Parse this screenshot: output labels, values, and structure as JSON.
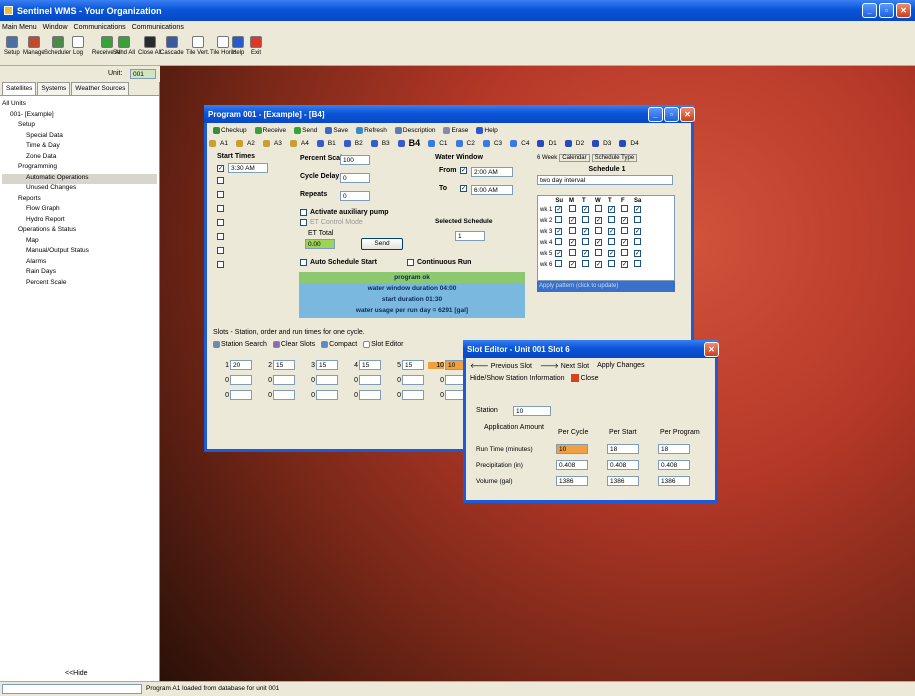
{
  "app_title": "Sentinel WMS - Your Organization",
  "menu": [
    "Main Menu",
    "Window",
    "Communications",
    "Communications"
  ],
  "toolbar": [
    {
      "label": "Setup",
      "icon": "setup-icon",
      "color": "#4a6fa5"
    },
    {
      "label": "Manage",
      "icon": "manage-icon",
      "color": "#c04a30"
    },
    {
      "label": "Scheduler",
      "icon": "scheduler-icon",
      "color": "#4a8a4a"
    },
    {
      "label": "Log",
      "icon": "log-icon",
      "color": "#ffffff"
    },
    {
      "label": "Receive All",
      "icon": "receive-all-icon",
      "color": "#3aa03a"
    },
    {
      "label": "Send All",
      "icon": "send-all-icon",
      "color": "#3aa03a"
    },
    {
      "label": "Close All",
      "icon": "close-all-icon",
      "color": "#2a2a2a"
    },
    {
      "label": "Cascade",
      "icon": "cascade-icon",
      "color": "#3a5aa0"
    },
    {
      "label": "Tile Vert.",
      "icon": "tile-vert-icon",
      "color": "#ffffff"
    },
    {
      "label": "Tile Horiz.",
      "icon": "tile-horiz-icon",
      "color": "#ffffff"
    },
    {
      "label": "Help",
      "icon": "help-icon",
      "color": "#2a5ac8"
    },
    {
      "label": "Exit",
      "icon": "exit-icon",
      "color": "#d83a2a"
    }
  ],
  "unit": {
    "label": "Unit:",
    "value": "001"
  },
  "left_tabs": [
    "Satellites",
    "Systems",
    "Weather Sources"
  ],
  "tree": [
    {
      "label": "All Units",
      "indent": 0
    },
    {
      "label": "001- [Example]",
      "indent": 1
    },
    {
      "label": "Setup",
      "indent": 2
    },
    {
      "label": "Special Data",
      "indent": 3
    },
    {
      "label": "Time & Day",
      "indent": 3
    },
    {
      "label": "Zone Data",
      "indent": 3
    },
    {
      "label": "Programming",
      "indent": 2
    },
    {
      "label": "Automatic Operations",
      "indent": 3
    },
    {
      "label": "Unused Changes",
      "indent": 3
    },
    {
      "label": "Reports",
      "indent": 2
    },
    {
      "label": "Flow Graph",
      "indent": 3
    },
    {
      "label": "Hydro Report",
      "indent": 3
    },
    {
      "label": "Operations & Status",
      "indent": 2
    },
    {
      "label": "Map",
      "indent": 3
    },
    {
      "label": "Manual/Output Status",
      "indent": 3
    },
    {
      "label": "Alarms",
      "indent": 3
    },
    {
      "label": "Rain Days",
      "indent": 3
    },
    {
      "label": "Percent Scale",
      "indent": 3
    }
  ],
  "hide_label": "<<Hide",
  "status_text": "Program A1 loaded from database for unit 001",
  "program": {
    "title": "Program 001 - [Example] - [B4]",
    "toolbar": [
      "Checkup",
      "Receive",
      "Send",
      "Save",
      "Refresh",
      "Description",
      "Erase",
      "Help"
    ],
    "tabs": [
      "A1",
      "A2",
      "A3",
      "A4",
      "B1",
      "B2",
      "B3",
      "B4",
      "C1",
      "C2",
      "C3",
      "C4",
      "D1",
      "D2",
      "D3",
      "D4"
    ],
    "start_times_label": "Start Times",
    "start_time": "3:30 AM",
    "percent_scale_label": "Percent Scale",
    "percent_scale": "100",
    "cycle_delay_label": "Cycle Delay",
    "cycle_delay": "0",
    "repeats_label": "Repeats",
    "repeats": "0",
    "aux_label": "Activate auxiliary pump",
    "et_mode_label": "ET Control Mode",
    "et_total_label": "ET Total",
    "et_total": "0.00",
    "send_label": "Send",
    "auto_label": "Auto Schedule Start",
    "continuous_label": "Continuous Run",
    "water_window_label": "Water Window",
    "from_label": "From",
    "from_time": "2:00 AM",
    "to_label": "To",
    "to_time": "6:00 AM",
    "selected_schedule_label": "Selected Schedule",
    "selected_schedule": "1",
    "sched_tabs": [
      "6 Week",
      "Calendar",
      "Schedule Type"
    ],
    "schedule_title": "Schedule 1",
    "schedule_name": "two day interval",
    "day_headers": [
      "Su",
      "M",
      "T",
      "W",
      "T",
      "F",
      "Sa"
    ],
    "weeks": [
      {
        "label": "wk 1",
        "checks": [
          1,
          0,
          1,
          0,
          1,
          0,
          1
        ]
      },
      {
        "label": "wk 2",
        "checks": [
          0,
          1,
          0,
          1,
          0,
          1,
          0
        ]
      },
      {
        "label": "wk 3",
        "checks": [
          1,
          0,
          1,
          0,
          1,
          0,
          1
        ]
      },
      {
        "label": "wk 4",
        "checks": [
          0,
          1,
          0,
          1,
          0,
          1,
          0
        ]
      },
      {
        "label": "wk 5",
        "checks": [
          1,
          0,
          1,
          0,
          1,
          0,
          1
        ]
      },
      {
        "label": "wk 6",
        "checks": [
          0,
          1,
          0,
          1,
          0,
          1,
          0
        ]
      }
    ],
    "apply_pattern": "Apply pattern (click to update)",
    "status_lines": [
      "program ok",
      "water window duration 04:00",
      "start duration 01:30",
      "water usage per run day = 6291 [gal]"
    ],
    "slots_caption": "Slots - Station, order and run times for one cycle.",
    "slots_toolbar": [
      "Station Search",
      "Clear Slots",
      "Compact",
      "Slot Editor"
    ],
    "slot_row1": [
      {
        "station": "1",
        "time": "20"
      },
      {
        "station": "2",
        "time": "15"
      },
      {
        "station": "3",
        "time": "15"
      },
      {
        "station": "4",
        "time": "15"
      },
      {
        "station": "5",
        "time": "15"
      },
      {
        "station": "10",
        "time": "10"
      }
    ],
    "slot_zero": "0"
  },
  "slot_editor": {
    "title": "Slot Editor - Unit 001 Slot 6",
    "prev": "Previous Slot",
    "next": "Next Slot",
    "apply": "Apply Changes",
    "hide_show": "Hide/Show Station Information",
    "close": "Close",
    "station_label": "Station",
    "station": "10",
    "app_amount_label": "Application Amount",
    "cols": [
      "Per Cycle",
      "Per Start",
      "Per Program"
    ],
    "rows": [
      {
        "label": "Run Time (minutes)",
        "values": [
          "10",
          "18",
          "18"
        ]
      },
      {
        "label": "Precipitation (in)",
        "values": [
          "0.408",
          "0.408",
          "0.408"
        ]
      },
      {
        "label": "Volume (gal)",
        "values": [
          "1386",
          "1386",
          "1386"
        ]
      }
    ]
  }
}
